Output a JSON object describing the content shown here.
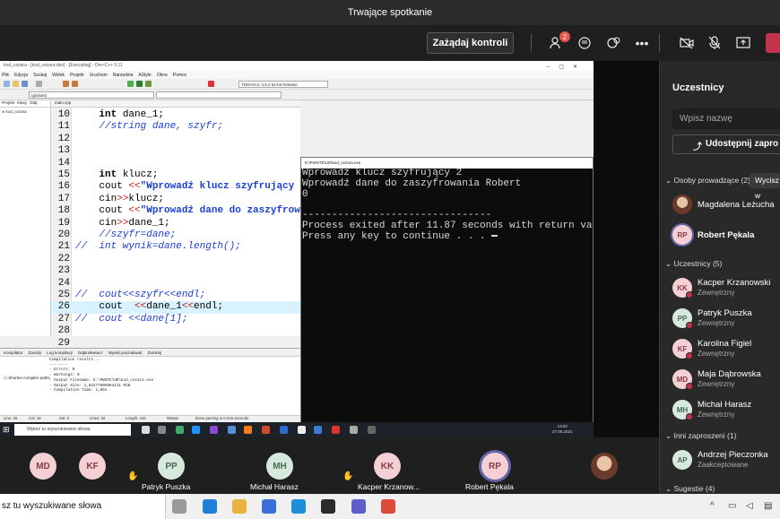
{
  "meeting": {
    "title": "Trwające spotkanie",
    "request_control_label": "Zażądaj kontroli",
    "participants_badge": "2"
  },
  "ide": {
    "window_title": "kod_cezara - [kod_cezara.dev] - [Executing] - Dev-C++ 5.11",
    "menu": [
      "Plik",
      "Edycja",
      "Szukaj",
      "Widok",
      "Projekt",
      "Uruchom",
      "Narzędzia",
      "AStyle",
      "Okno",
      "Pomoc"
    ],
    "compiler_select": "TDM-GCC 4.9.2 64-bit Release",
    "scope_select": "(globals)",
    "project_tabs": [
      "Projekt",
      "Klasy",
      "Odp"
    ],
    "project_item": "kod_cezara",
    "editor_tab": "main.cpp",
    "code_lines": [
      {
        "n": "10",
        "segs": [
          {
            "t": "    ",
            "c": ""
          },
          {
            "t": "int",
            "c": "kw"
          },
          {
            "t": " dane_1;",
            "c": ""
          }
        ]
      },
      {
        "n": "11",
        "segs": [
          {
            "t": "    ",
            "c": ""
          },
          {
            "t": "//string dane, szyfr;",
            "c": "cm"
          }
        ]
      },
      {
        "n": "12",
        "segs": []
      },
      {
        "n": "13",
        "segs": []
      },
      {
        "n": "14",
        "segs": []
      },
      {
        "n": "15",
        "segs": [
          {
            "t": "    ",
            "c": ""
          },
          {
            "t": "int",
            "c": "kw"
          },
          {
            "t": " klucz;",
            "c": ""
          }
        ]
      },
      {
        "n": "16",
        "segs": [
          {
            "t": "    cout ",
            "c": ""
          },
          {
            "t": "<<",
            "c": "op"
          },
          {
            "t": "\"Wprowadź klucz szyfrujący \"",
            "c": "st"
          },
          {
            "t": ";",
            "c": ""
          }
        ]
      },
      {
        "n": "17",
        "segs": [
          {
            "t": "    cin",
            "c": ""
          },
          {
            "t": ">>",
            "c": "op"
          },
          {
            "t": "klucz;",
            "c": ""
          }
        ]
      },
      {
        "n": "18",
        "segs": [
          {
            "t": "    cout ",
            "c": ""
          },
          {
            "t": "<<",
            "c": "op"
          },
          {
            "t": "\"Wprowadź dane do zaszyfrowania",
            "c": "st"
          }
        ]
      },
      {
        "n": "19",
        "segs": [
          {
            "t": "    cin",
            "c": ""
          },
          {
            "t": ">>",
            "c": "op"
          },
          {
            "t": "dane_1;",
            "c": ""
          }
        ]
      },
      {
        "n": "20",
        "segs": [
          {
            "t": "    ",
            "c": ""
          },
          {
            "t": "//szyfr=dane;",
            "c": "cm"
          }
        ]
      },
      {
        "n": "21",
        "segs": [
          {
            "t": "//  int wynik=dane.length();",
            "c": "cm"
          }
        ]
      },
      {
        "n": "22",
        "segs": []
      },
      {
        "n": "23",
        "segs": []
      },
      {
        "n": "24",
        "segs": []
      },
      {
        "n": "25",
        "segs": [
          {
            "t": "//  cout<<szyfr<<endl;",
            "c": "cm"
          }
        ]
      },
      {
        "n": "26",
        "segs": [
          {
            "t": "    cout  ",
            "c": ""
          },
          {
            "t": "<<",
            "c": "op"
          },
          {
            "t": "dane_1",
            "c": ""
          },
          {
            "t": "<<",
            "c": "op"
          },
          {
            "t": "endl;",
            "c": ""
          }
        ],
        "hl": true
      },
      {
        "n": "27",
        "segs": [
          {
            "t": "//  cout <<dane[1];",
            "c": "cm"
          }
        ]
      },
      {
        "n": "28",
        "segs": []
      },
      {
        "n": "29",
        "segs": []
      }
    ],
    "bottom_tabs": [
      "Kompilator",
      "Zasoby",
      "Log kompilacji",
      "Odpluskwiacz",
      "Wyniki poszukiwań",
      "Zamknij"
    ],
    "compile_log": "Compilation results...\n--------\n- Errors: 0\n- Warnings: 0\n- Output Filename: E:\\PWSTE\\UD\\kod_cezara.exe\n- Output Size: 1,83277606964111 MiB\n- Compilation Time: 1,66s",
    "shorten_paths": "Shorten compiler paths",
    "status": {
      "line": "26",
      "col": "18",
      "sel": "0",
      "lines": "32",
      "length": "416",
      "mode": "Wstaw",
      "parse": "Done parsing in 0,016 seconds"
    }
  },
  "console": {
    "title": "E:\\PWSTE\\UD\\kod_cezara.exe",
    "lines": [
      "Wprowadź klucz szyfrujący 2",
      "Wprowadź dane do zaszyfrowania Robert",
      "0",
      "",
      "--------------------------------",
      "Process exited after 11.87 seconds with return va",
      "Press any key to continue . . . "
    ]
  },
  "shared_taskbar": {
    "search_placeholder": "Wpisz tu wyszukiwane słowa",
    "time": "13:02",
    "date": "27.05.2021"
  },
  "roster": {
    "title": "Uczestnicy",
    "search_placeholder": "Wpisz nazwę",
    "share_invite_label": "Udostępnij zapro",
    "presenters_heading": "Osoby prowadzące (2)",
    "mute_all_label": "Wycisz w",
    "presenters": [
      {
        "name": "Magdalena Leżucha",
        "initials": "",
        "sub": "",
        "photo": true
      },
      {
        "name": "Robert Pękala",
        "initials": "RP",
        "sub": "",
        "bold": true
      }
    ],
    "attendees_heading": "Uczestnicy (5)",
    "attendees": [
      {
        "name": "Kacper Krzanowski",
        "initials": "KK",
        "sub": "Zewnętrzny"
      },
      {
        "name": "Patryk Puszka",
        "initials": "PP",
        "sub": "Zewnętrzny"
      },
      {
        "name": "Karolina Figiel",
        "initials": "KF",
        "sub": "Zewnętrzny"
      },
      {
        "name": "Maja Dąbrowska",
        "initials": "MD",
        "sub": "Zewnętrzny"
      },
      {
        "name": "Michał Harasz",
        "initials": "MH",
        "sub": "Zewnętrzny"
      }
    ],
    "others_heading": "Inni zaproszeni (1)",
    "others": [
      {
        "name": "Andrzej Pieczonka",
        "initials": "AP",
        "sub": "Zaakceptowane"
      }
    ],
    "suggestions_heading": "Sugestie (4)"
  },
  "gallery": [
    {
      "initials": "MD",
      "name": ""
    },
    {
      "initials": "KF",
      "name": ""
    },
    {
      "initials": "PP",
      "name": "Patryk Puszka"
    },
    {
      "initials": "MH",
      "name": "Michał Harasz"
    },
    {
      "initials": "KK",
      "name": "Kacper Krzanow..."
    },
    {
      "initials": "RP",
      "name": "Robert Pękala"
    }
  ],
  "host_taskbar": {
    "search_text": "sz tu wyszukiwane słowa"
  },
  "colors": {
    "avatar_bg_grey": "#e9e9e9",
    "avatar_bg_pink": "#f4d0d5",
    "avatar_bg_green": "#d7e8dc",
    "status_dnd": "#c4314b",
    "accent_leave": "#c4314b"
  }
}
